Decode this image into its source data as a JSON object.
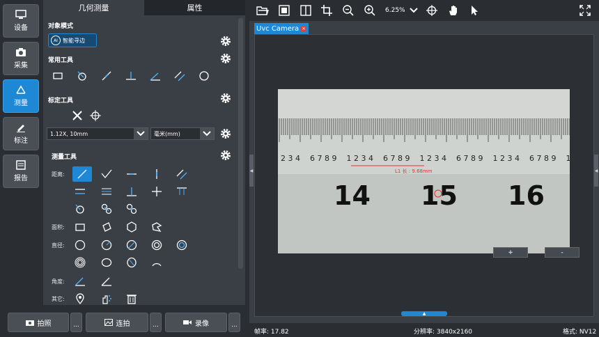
{
  "nav": [
    {
      "label": "设备",
      "icon": "monitor-icon"
    },
    {
      "label": "采集",
      "icon": "camera-icon"
    },
    {
      "label": "测量",
      "icon": "measure-icon",
      "active": true
    },
    {
      "label": "标注",
      "icon": "pen-icon"
    },
    {
      "label": "报告",
      "icon": "report-icon"
    }
  ],
  "panel": {
    "tabs": [
      "几何测量",
      "属性"
    ],
    "object_mode": "对象模式",
    "ai_button": "智能寻边",
    "ai_badge": "AI",
    "common_tools": "常用工具",
    "calib_tools": "标定工具",
    "calib_select": "1.12X, 10mm",
    "unit_select": "毫米(mm)",
    "measure_tools": "测量工具",
    "row_labels": {
      "distance": "距离:",
      "area": "面积:",
      "diameter": "直径:",
      "angle": "角度:",
      "other": "其它:"
    }
  },
  "bottom": {
    "photo": "拍照",
    "burst": "连拍",
    "record": "录像",
    "more": "..."
  },
  "toolbar": {
    "zoom": "6.25%"
  },
  "viewer": {
    "tab_title": "Uvc Camera",
    "zoom_in": "+",
    "zoom_out": "-"
  },
  "camera": {
    "numbers": [
      "14",
      "15",
      "16"
    ],
    "annotation": "L1 长 : 9.68mm"
  },
  "status": {
    "fps": "帧率: 17.82",
    "resolution": "分辨率: 3840x2160",
    "format": "格式: NV12"
  },
  "colors": {
    "accent": "#1e88d4",
    "panel": "#3a3e45",
    "bg": "#2a2d32"
  }
}
